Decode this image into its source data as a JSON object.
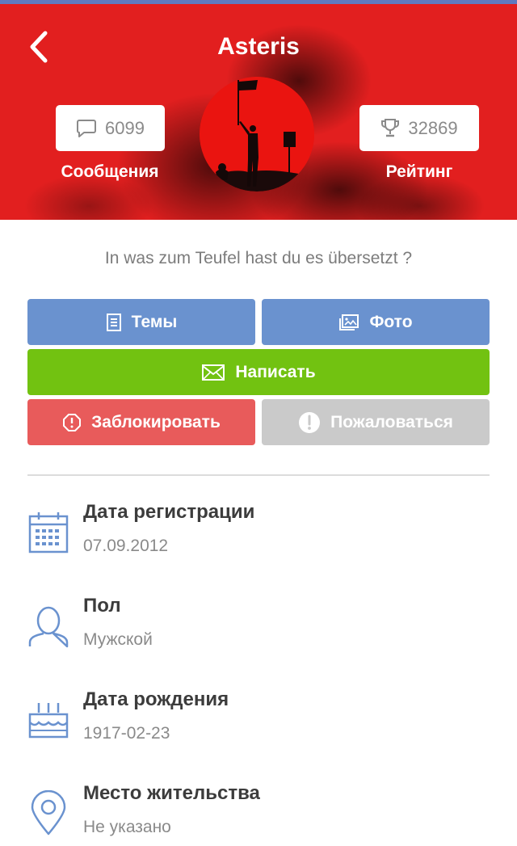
{
  "header": {
    "title": "Asteris",
    "back_icon": "chevron-left-icon",
    "background_color": "#e21f1f",
    "messages": {
      "count": "6099",
      "label": "Сообщения",
      "icon": "speech-bubble-icon"
    },
    "rating": {
      "count": "32869",
      "label": "Рейтинг",
      "icon": "trophy-icon"
    }
  },
  "status_text": "In was zum Teufel hast du es übersetzt ?",
  "buttons": {
    "topics": "Темы",
    "photos": "Фото",
    "write": "Написать",
    "block": "Заблокировать",
    "report": "Пожаловаться"
  },
  "colors": {
    "blue": "#6a92cf",
    "green": "#72c211",
    "red": "#e85b5b",
    "grey": "#cacaca"
  },
  "info": [
    {
      "label": "Дата регистрации",
      "value": "07.09.2012",
      "icon": "calendar-icon"
    },
    {
      "label": "Пол",
      "value": "Мужской",
      "icon": "user-icon"
    },
    {
      "label": "Дата рождения",
      "value": "1917-02-23",
      "icon": "birthday-cake-icon"
    },
    {
      "label": "Место жительства",
      "value": "Не указано",
      "icon": "location-pin-icon"
    }
  ]
}
